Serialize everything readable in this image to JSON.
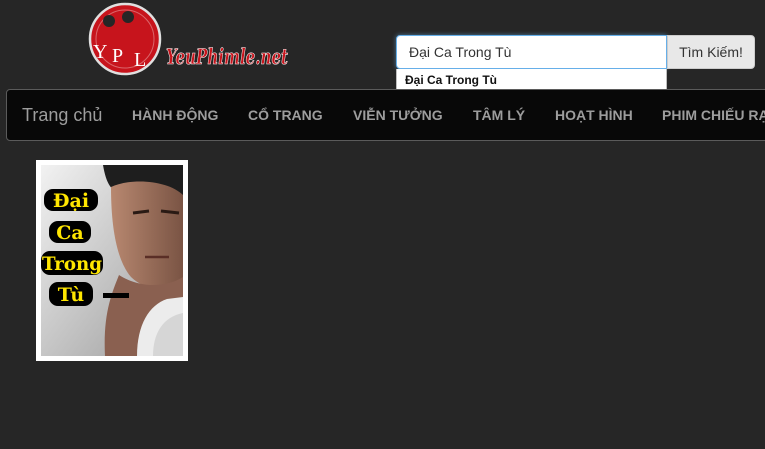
{
  "logo": {
    "initials": [
      "Y",
      "P",
      "L"
    ],
    "site_name": "YeuPhimle.net",
    "brand_color": "#c7141c"
  },
  "search": {
    "value": "Đại Ca Trong Tù",
    "button_label": "Tìm Kiếm!",
    "suggestions": [
      "Đại Ca Trong Tù"
    ]
  },
  "nav": {
    "brand": "Trang chủ",
    "items": [
      "HÀNH ĐỘNG",
      "CỔ TRANG",
      "VIỄN TƯỞNG",
      "TÂM LÝ",
      "HOẠT HÌNH",
      "PHIM CHIẾU RẠP"
    ]
  },
  "movies": [
    {
      "poster_lines": [
        "Đại",
        "Ca",
        "Trong",
        "Tù"
      ]
    }
  ],
  "colors": {
    "background": "#262626",
    "navbar": "#080808",
    "nav_text": "#9d9d9d",
    "input_focus": "#66afe9",
    "poster_text": "#ffe600"
  }
}
